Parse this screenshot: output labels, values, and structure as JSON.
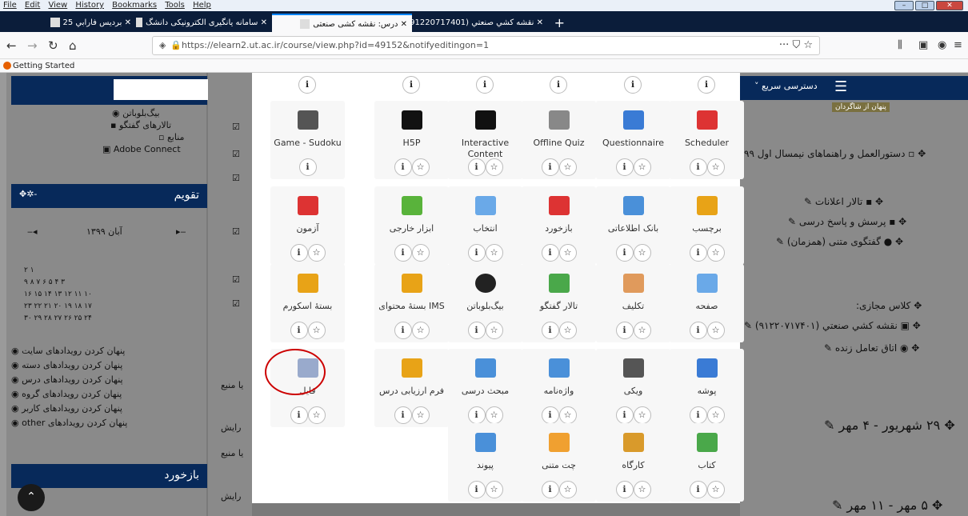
{
  "menu": [
    "File",
    "Edit",
    "View",
    "History",
    "Bookmarks",
    "Tools",
    "Help"
  ],
  "tabs": [
    {
      "title": "برديس فارابي 25"
    },
    {
      "title": "سامانه یانگیری الکترونیکی دانشگ"
    },
    {
      "title": "درس: نقشه کشی صنعتی"
    },
    {
      "title": "نقشه کشي صنعتي (91220717401"
    }
  ],
  "url": "https://elearn2.ut.ac.ir/course/view.php?id=49152&notifyeditingon=1",
  "url_domain": "ut.ac.ir",
  "bookmarks": {
    "getting_started": "Getting Started"
  },
  "left": {
    "top_items": [
      "بیگ‌بلوباتن",
      "تالارهای گفتگو",
      "منابع",
      "Adobe Connect"
    ],
    "calendar_title": "تقویم",
    "month": "آبان ۱۳۹۹",
    "week_rows": [
      "۲   ۱",
      "۹   ۸   ۷   ۶   ۵   ۴   ۳",
      "۱۶  ۱۵  ۱۴  ۱۳  ۱۲  ۱۱  ۱۰",
      "۲۳  ۲۲  ۲۱  ۲۰  ۱۹  ۱۸  ۱۷",
      "۳۰  ۲۹  ۲۸  ۲۷  ۲۶  ۲۵  ۲۴"
    ],
    "event_filters": [
      "پنهان کردن رویدادهای سایت",
      "پنهان کردن رویدادهای دسته",
      "پنهان کردن رویدادهای درس",
      "پنهان کردن رویدادهای گروه",
      "پنهان کردن رویدادهای کاربر",
      "پنهان کردن رویدادهای other"
    ],
    "feedback_title": "بازخورد"
  },
  "middle": {
    "resource1": "یا منبع",
    "edit1": "رایش",
    "resource2": "یا منبع",
    "edit2": "رایش"
  },
  "right": {
    "quick_access": "دسترسی سریع",
    "hidden_badge": "پنهان از شاگردان",
    "items": [
      "دستورالعمل و راهنماهای نیمسال اول ۹۹",
      "تالار اعلانات",
      "پرسش و پاسخ درسی",
      "گفتگوی متنی (همزمان)",
      "کلاس مجازی:",
      "نقشه کشي صنعتي (۹۱۲۲۰۷۱۷۴۰۱)",
      "اتاق تعامل زنده"
    ],
    "section1": "۲۹ شهریور - ۴ مهر",
    "section2": "۵ مهر - ۱۱ مهر"
  },
  "activities": [
    {
      "label": "Scheduler",
      "icon": "calendar-icon"
    },
    {
      "label": "Questionnaire",
      "icon": "questionnaire-icon"
    },
    {
      "label": "Offline Quiz",
      "icon": "offline-quiz-icon"
    },
    {
      "label": "Interactive Content",
      "icon": "h5p-icon"
    },
    {
      "label": "H5P",
      "icon": "h5p-icon"
    },
    {
      "label": "Game - Sudoku",
      "icon": "sudoku-icon"
    },
    {
      "label": "برچسب",
      "icon": "label-icon"
    },
    {
      "label": "بانک اطلاعاتی",
      "icon": "database-icon"
    },
    {
      "label": "بازخورد",
      "icon": "feedback-icon"
    },
    {
      "label": "انتخاب",
      "icon": "choice-icon"
    },
    {
      "label": "ابزار خارجی",
      "icon": "puzzle-icon"
    },
    {
      "label": "آزمون",
      "icon": "quiz-icon"
    },
    {
      "label": "صفحه",
      "icon": "page-icon"
    },
    {
      "label": "تکلیف",
      "icon": "assignment-icon"
    },
    {
      "label": "تالار گفتگو",
      "icon": "forum-icon"
    },
    {
      "label": "بیگ‌بلوباتن",
      "icon": "bigbluebutton-icon"
    },
    {
      "label": "بستهٔ محتوای IMS",
      "icon": "ims-icon"
    },
    {
      "label": "بستهٔ اسکورم",
      "icon": "scorm-icon"
    },
    {
      "label": "پوشه",
      "icon": "folder-icon"
    },
    {
      "label": "ویکی",
      "icon": "wiki-icon"
    },
    {
      "label": "واژه‌نامه",
      "icon": "glossary-icon"
    },
    {
      "label": "مبحث درسی",
      "icon": "lesson-icon"
    },
    {
      "label": "فرم ارزیابی درس",
      "icon": "survey-icon"
    },
    {
      "label": "فایل",
      "icon": "file-icon"
    },
    {
      "label": "کتاب",
      "icon": "book-icon"
    },
    {
      "label": "کارگاه",
      "icon": "workshop-icon"
    },
    {
      "label": "چت متنی",
      "icon": "chat-icon"
    },
    {
      "label": "پیوند",
      "icon": "url-icon"
    }
  ],
  "colors": {
    "accent": "#07295a",
    "highlight_circle": "#cc0000"
  }
}
